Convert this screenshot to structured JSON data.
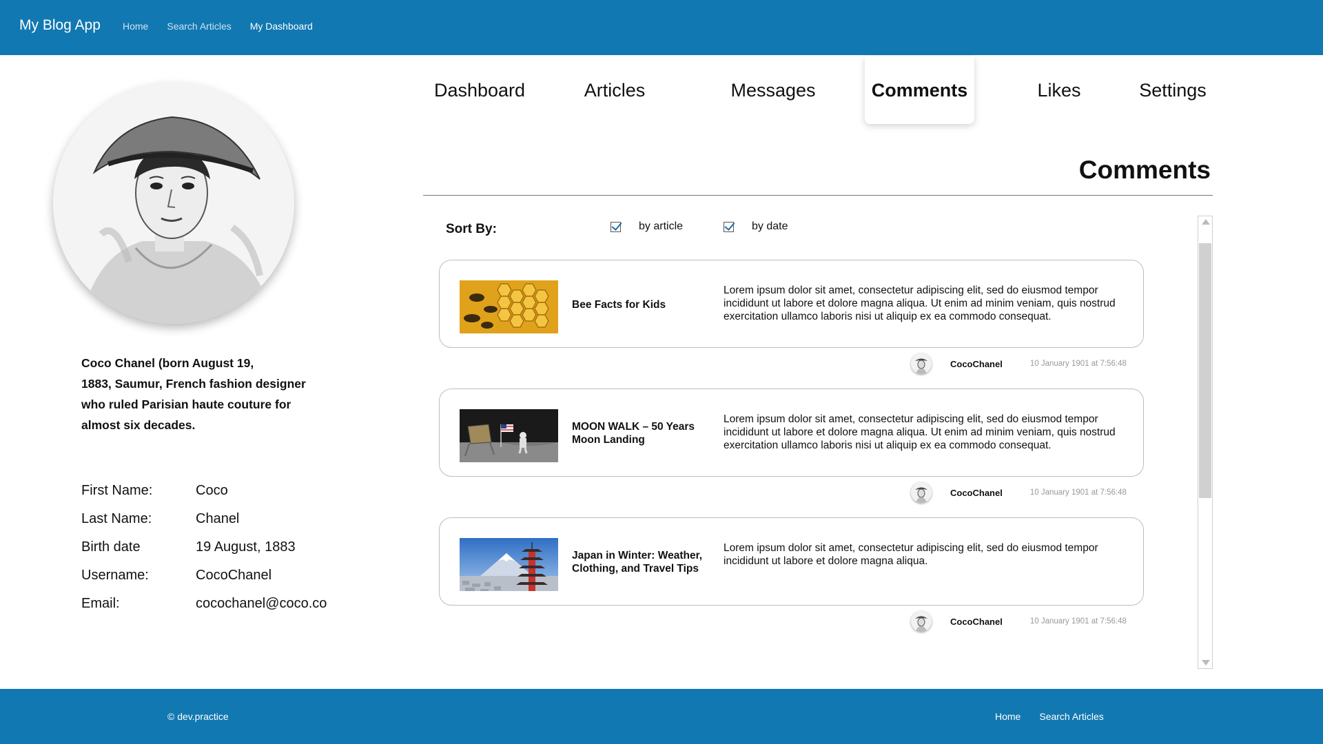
{
  "app": {
    "title": "My Blog App"
  },
  "topnav": {
    "items": [
      "Home",
      "Search Articles",
      "My Dashboard"
    ],
    "active": "My Dashboard"
  },
  "colors": {
    "brand": "#1178b1",
    "check": "#1a6fb0"
  },
  "profile": {
    "bio": "Coco Chanel (born August 19,\n1883, Saumur,  French fashion designer\nwho ruled Parisian haute couture for\nalmost six decades.",
    "fields": [
      {
        "label": "First Name:",
        "value": "Coco"
      },
      {
        "label": "Last Name:",
        "value": "Chanel"
      },
      {
        "label": "Birth date",
        "value": "19 August, 1883"
      },
      {
        "label": "Username:",
        "value": "CocoChanel"
      },
      {
        "label": "Email:",
        "value": "cocochanel@coco.co"
      }
    ]
  },
  "tabs": [
    "Dashboard",
    "Articles",
    "Messages",
    "Comments",
    "Likes",
    "Settings"
  ],
  "active_tab": "Comments",
  "section": {
    "title": "Comments"
  },
  "sort": {
    "label": "Sort By:",
    "options": [
      {
        "label": "by article",
        "checked": true
      },
      {
        "label": "by date",
        "checked": true
      }
    ]
  },
  "comments": [
    {
      "article": "Bee Facts for Kids",
      "text": "Lorem ipsum dolor sit amet, consectetur adipiscing elit, sed do eiusmod tempor incididunt ut labore et dolore magna aliqua. Ut enim ad minim veniam, quis nostrud exercitation ullamco laboris nisi ut aliquip ex ea commodo consequat.",
      "user": "CocoChanel",
      "date": "10 January 1901 at 7:56:48",
      "image": "honeycomb-bees-image"
    },
    {
      "article": "MOON WALK – 50 Years Moon Landing",
      "text": "Lorem ipsum dolor sit amet, consectetur adipiscing elit, sed do eiusmod tempor incididunt ut labore et dolore magna aliqua. Ut enim ad minim veniam, quis nostrud exercitation ullamco laboris nisi ut aliquip ex ea commodo consequat.",
      "user": "CocoChanel",
      "date": "10 January 1901 at 7:56:48",
      "image": "moon-landing-image"
    },
    {
      "article": "Japan in Winter: Weather, Clothing, and Travel Tips",
      "text": "Lorem ipsum dolor sit amet, consectetur adipiscing elit, sed do eiusmod tempor incididunt ut labore et dolore magna aliqua.",
      "user": "CocoChanel",
      "date": "10 January 1901 at 7:56:48",
      "image": "japan-pagoda-image"
    }
  ],
  "footer": {
    "copyright": "© dev.practice",
    "links": [
      "Home",
      "Search Articles"
    ]
  }
}
